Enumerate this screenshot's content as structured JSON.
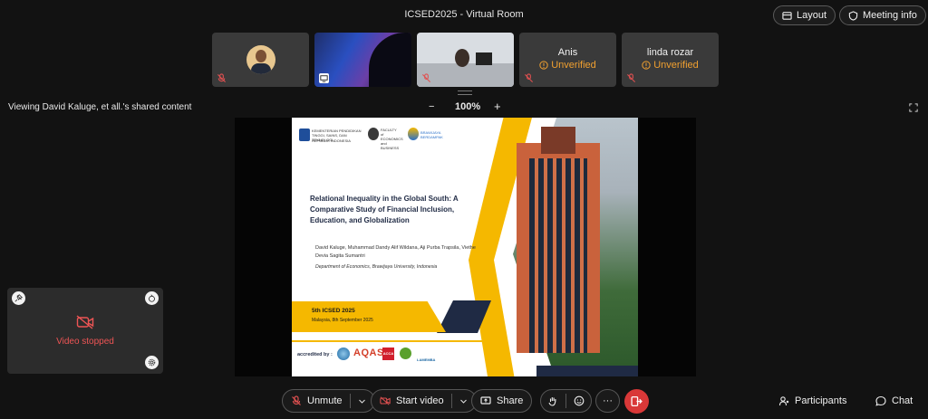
{
  "window": {
    "title": "ICSED2025 - Virtual Room"
  },
  "header": {
    "layout_label": "Layout",
    "meeting_info_label": "Meeting info"
  },
  "participants_strip": [
    {
      "name": "",
      "status": ""
    },
    {
      "name": "",
      "status": ""
    },
    {
      "name": "",
      "status": ""
    },
    {
      "name": "Anis",
      "status": "Unverified"
    },
    {
      "name": "linda rozar",
      "status": "Unverified"
    }
  ],
  "share_bar": {
    "viewing_text": "Viewing David Kaluge, et all.'s shared content",
    "zoom_minus": "−",
    "zoom_level": "100%",
    "zoom_plus": "+"
  },
  "slide": {
    "institution_1": "KEMENTERIAN PENDIDIKAN TINGGI, SAINS, DAN TEKNOLOGI",
    "institution_1b": "REPUBLIK INDONESIA",
    "institution_2": "FACULTY of ECONOMICS and BUSINESS",
    "institution_3": "BRAWIJAYA BERDAMPAK",
    "title": "Relational Inequality in the Global South: A Comparative Study of Financial Inclusion, Education, and Globalization",
    "authors": "David Kaluge, Muhammad Dandy Alif Wildana, Aji Purba Trapsila, Viethe Devia Sagita Sumantri",
    "department": "Department of Economics, Brawijaya University, Indonesia",
    "event": "5th ICSED 2025",
    "date": "Malaysia, 8th September 2025",
    "accredited": "accredited by :",
    "acc_aqas": "AQAS",
    "acc_acca": "ACCA",
    "acc_lamemba": "LAMEMBA"
  },
  "self_view": {
    "status": "Video stopped"
  },
  "toolbar": {
    "unmute_label": "Unmute",
    "start_video_label": "Start video",
    "share_label": "Share",
    "more_label": "···",
    "participants_label": "Participants",
    "chat_label": "Chat"
  },
  "colors": {
    "unverified": "#f0a030",
    "danger": "#d93838",
    "slide_yellow": "#f5b800",
    "slide_navy": "#1f2a44"
  }
}
